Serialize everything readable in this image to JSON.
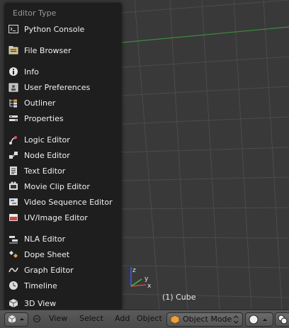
{
  "menu": {
    "title": "Editor Type",
    "items": [
      {
        "label": "Python Console",
        "icon": "python-console-icon"
      },
      {
        "label": "File Browser",
        "icon": "file-browser-icon"
      },
      {
        "label": "Info",
        "icon": "info-icon"
      },
      {
        "label": "User Preferences",
        "icon": "user-preferences-icon"
      },
      {
        "label": "Outliner",
        "icon": "outliner-icon"
      },
      {
        "label": "Properties",
        "icon": "properties-icon"
      },
      {
        "label": "Logic Editor",
        "icon": "logic-editor-icon"
      },
      {
        "label": "Node Editor",
        "icon": "node-editor-icon"
      },
      {
        "label": "Text Editor",
        "icon": "text-editor-icon"
      },
      {
        "label": "Movie Clip Editor",
        "icon": "movie-clip-editor-icon"
      },
      {
        "label": "Video Sequence Editor",
        "icon": "video-sequence-editor-icon"
      },
      {
        "label": "UV/Image Editor",
        "icon": "uv-image-editor-icon"
      },
      {
        "label": "NLA Editor",
        "icon": "nla-editor-icon"
      },
      {
        "label": "Dope Sheet",
        "icon": "dope-sheet-icon"
      },
      {
        "label": "Graph Editor",
        "icon": "graph-editor-icon"
      },
      {
        "label": "Timeline",
        "icon": "timeline-icon"
      },
      {
        "label": "3D View",
        "icon": "3d-view-icon"
      }
    ]
  },
  "viewport": {
    "object_label": "(1) Cube",
    "axis_x": "x",
    "axis_y": "y",
    "axis_z": "z"
  },
  "header": {
    "view": "View",
    "select": "Select",
    "add": "Add",
    "object": "Object",
    "mode": "Object Mode"
  },
  "colors": {
    "menu_bg": "#1e1e1e",
    "viewport_bg": "#393939",
    "grid": "#4c4c4c",
    "x_axis_line": "#3d8a3d",
    "object_mode_icon": "#e8a040"
  }
}
